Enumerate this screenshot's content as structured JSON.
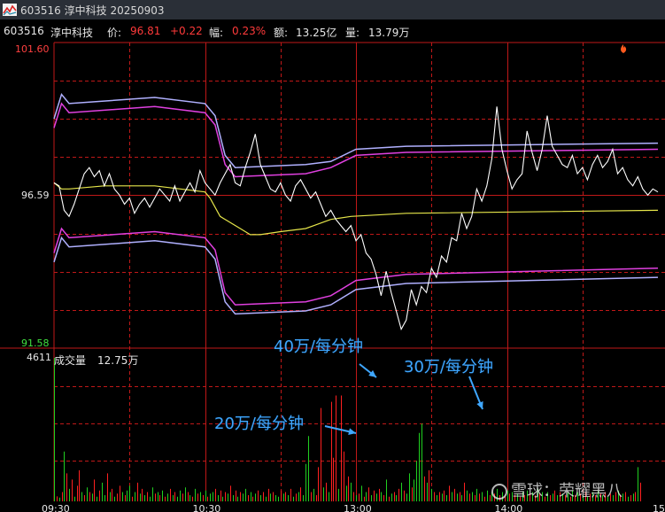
{
  "window": {
    "title": "603516 淳中科技 20250903"
  },
  "info": {
    "code": "603516",
    "name": "淳中科技",
    "price_label": "价:",
    "price": "96.81",
    "change": "+0.22",
    "amplitude_label": "幅:",
    "amplitude": "0.23%",
    "amount_label": "额:",
    "amount": "13.25亿",
    "volume_label": "量:",
    "volume": "13.79万"
  },
  "price_axis": {
    "top": "101.60",
    "mid": "96.59",
    "bottom": "91.58"
  },
  "volume_panel": {
    "max_label": "4611",
    "title": "成交量",
    "total": "12.75万"
  },
  "time_axis": [
    "09:30",
    "10:30",
    "13:00",
    "14:00",
    "15:0"
  ],
  "annotations": {
    "a40": "40万/每分钟",
    "a30": "30万/每分钟",
    "a20": "20万/每分钟"
  },
  "watermark": "雪球：荣耀黑八",
  "colors": {
    "background": "#000000",
    "grid_red": "#c01818",
    "price_line": "#ffffff",
    "avg_line": "#e6e64a",
    "band_magenta": "#e040e0",
    "band_lavender": "#b0b0ff",
    "up": "#ff2020",
    "down": "#20d020",
    "annotation": "#3fa7ff"
  },
  "chart_data": {
    "type": "line",
    "title": "",
    "ylim": [
      91.58,
      101.6
    ],
    "price_x": [
      0,
      2,
      4,
      6,
      8,
      10,
      12,
      14,
      16,
      18,
      20,
      22,
      24,
      26,
      28,
      30,
      32,
      34,
      36,
      38,
      40,
      42,
      44,
      46,
      48,
      50,
      52,
      54,
      56,
      58,
      60,
      62,
      64,
      66,
      68,
      70,
      72,
      74,
      76,
      78,
      80,
      82,
      84,
      86,
      88,
      90,
      92,
      94,
      96,
      98,
      100,
      102,
      104,
      106,
      108,
      110,
      112,
      114,
      116,
      118,
      120,
      122,
      124,
      126,
      128,
      130,
      132,
      134,
      136,
      138,
      140,
      142,
      144,
      146,
      148,
      150,
      152,
      154,
      156,
      158,
      160,
      162,
      164,
      166,
      168,
      170,
      172,
      174,
      176,
      178,
      180,
      182,
      184,
      186,
      188,
      190,
      192,
      194,
      196,
      198,
      200,
      202,
      204,
      206,
      208,
      210,
      212,
      214,
      216,
      218,
      220,
      222,
      224,
      226,
      228,
      230,
      232,
      234,
      236,
      238,
      240
    ],
    "price": [
      97.0,
      96.9,
      96.1,
      95.9,
      96.3,
      96.8,
      97.3,
      97.5,
      97.2,
      97.4,
      96.9,
      97.3,
      96.8,
      96.6,
      96.3,
      96.5,
      96.0,
      96.3,
      96.5,
      96.2,
      96.5,
      96.8,
      96.6,
      96.4,
      96.9,
      96.4,
      96.7,
      97.0,
      96.7,
      97.4,
      97.0,
      96.8,
      96.6,
      97.0,
      97.3,
      97.6,
      97.0,
      96.9,
      97.5,
      98.0,
      98.6,
      97.6,
      97.2,
      96.8,
      96.7,
      97.0,
      96.6,
      96.4,
      96.9,
      97.1,
      96.8,
      96.5,
      96.7,
      96.3,
      95.9,
      96.1,
      95.8,
      95.6,
      95.4,
      95.6,
      95.1,
      95.3,
      94.7,
      94.5,
      94.0,
      93.3,
      94.1,
      93.4,
      92.8,
      92.2,
      92.5,
      93.5,
      93.0,
      93.6,
      93.4,
      94.2,
      93.9,
      94.6,
      94.4,
      95.2,
      95.1,
      96.0,
      95.5,
      95.9,
      96.8,
      96.4,
      96.9,
      97.8,
      99.5,
      98.1,
      97.4,
      96.8,
      97.1,
      97.3,
      98.7,
      98.0,
      97.4,
      98.1,
      99.2,
      98.2,
      97.9,
      97.6,
      97.5,
      97.9,
      97.3,
      97.5,
      97.1,
      97.6,
      97.9,
      97.5,
      97.7,
      98.1,
      97.3,
      97.5,
      97.1,
      96.9,
      97.2,
      96.8,
      96.6,
      96.8,
      96.7
    ],
    "series": [
      {
        "values_x": [
          0,
          3,
          6,
          20,
          40,
          60,
          62,
          66,
          70,
          74,
          78,
          82,
          90,
          100,
          110,
          118,
          140,
          240
        ],
        "values": [
          97.0,
          96.8,
          96.8,
          96.9,
          96.9,
          96.7,
          96.5,
          95.9,
          95.7,
          95.5,
          95.3,
          95.3,
          95.4,
          95.5,
          95.8,
          95.9,
          96.0,
          96.1
        ]
      },
      {
        "values_x": [
          0,
          3,
          6,
          40,
          60,
          64,
          68,
          72,
          100,
          110,
          120,
          140,
          240
        ],
        "values": [
          99.1,
          99.9,
          99.6,
          99.8,
          99.6,
          99.2,
          97.9,
          97.5,
          97.6,
          97.7,
          98.1,
          98.2,
          98.3
        ]
      },
      {
        "values_x": [
          0,
          3,
          6,
          40,
          60,
          64,
          68,
          72,
          100,
          110,
          120,
          140,
          240
        ],
        "values": [
          98.8,
          99.6,
          99.3,
          99.5,
          99.3,
          98.9,
          97.6,
          97.2,
          97.3,
          97.5,
          97.9,
          98.0,
          98.1
        ]
      },
      {
        "values_x": [
          0,
          3,
          6,
          40,
          60,
          64,
          68,
          72,
          100,
          110,
          120,
          140,
          240
        ],
        "values": [
          94.7,
          95.5,
          95.2,
          95.4,
          95.2,
          94.8,
          93.4,
          93.0,
          93.1,
          93.3,
          93.8,
          94.0,
          94.2
        ]
      },
      {
        "values_x": [
          0,
          3,
          6,
          40,
          60,
          64,
          68,
          72,
          100,
          110,
          120,
          140,
          240
        ],
        "values": [
          94.4,
          95.2,
          94.9,
          95.1,
          94.9,
          94.5,
          93.1,
          92.7,
          92.8,
          93.0,
          93.5,
          93.7,
          93.9
        ]
      }
    ],
    "volume_ylim": [
      0,
      4611
    ],
    "volume": [
      4611,
      160,
      120,
      300,
      1600,
      900,
      400,
      700,
      150,
      500,
      1000,
      300,
      200,
      450,
      300,
      250,
      700,
      150,
      350,
      600,
      200,
      900,
      300,
      400,
      150,
      250,
      500,
      300,
      200,
      350,
      500,
      150,
      300,
      600,
      250,
      400,
      200,
      300,
      150,
      450,
      250,
      300,
      200,
      350,
      150,
      250,
      400,
      200,
      300,
      150,
      350,
      250,
      450,
      300,
      200,
      150,
      400,
      250,
      300,
      200,
      350,
      150,
      250,
      300,
      400,
      200,
      350,
      150,
      300,
      250,
      500,
      200,
      350,
      150,
      300,
      250,
      400,
      200,
      300,
      150,
      250,
      350,
      200,
      300,
      150,
      400,
      250,
      300,
      200,
      150,
      350,
      250,
      300,
      200,
      400,
      150,
      250,
      300,
      450,
      200,
      1200,
      2100,
      300,
      400,
      200,
      1100,
      3000,
      450,
      600,
      300,
      3200,
      1400,
      3400,
      400,
      3400,
      1600,
      500,
      800,
      600,
      300,
      200,
      250,
      500,
      150,
      300,
      450,
      200,
      350,
      250,
      400,
      300,
      200,
      700,
      150,
      250,
      300,
      200,
      400,
      600,
      350,
      250,
      900,
      450,
      700,
      1300,
      2200,
      2500,
      800,
      600,
      1000,
      400,
      300,
      200,
      300,
      250,
      350,
      200,
      500,
      300,
      400,
      250,
      300,
      200,
      600,
      350,
      250,
      300,
      200,
      400,
      250,
      300,
      150,
      350,
      200,
      300,
      250,
      400,
      200,
      300,
      150,
      350,
      250,
      300,
      200,
      250,
      150,
      300,
      200,
      350,
      250,
      300,
      200,
      400,
      250,
      300,
      150,
      300,
      200,
      250,
      350,
      200,
      300,
      250,
      200,
      300,
      150,
      350,
      200,
      300,
      250,
      200,
      300,
      150,
      250,
      300,
      200,
      350,
      250,
      200,
      300,
      150,
      250,
      200,
      300,
      350,
      200,
      250,
      300,
      150,
      200,
      250,
      300,
      1100,
      600
    ],
    "volume_dir": [
      1,
      0,
      1,
      0,
      1,
      0,
      1,
      0,
      1,
      0,
      0,
      1,
      0,
      1,
      0,
      1,
      0,
      1,
      0,
      1,
      1,
      0,
      1,
      0,
      1,
      0,
      0,
      1,
      0,
      1,
      1,
      0,
      1,
      0,
      1,
      0,
      1,
      0,
      1,
      1,
      0,
      1,
      0,
      1,
      0,
      1,
      0,
      1,
      0,
      1,
      1,
      0,
      1,
      0,
      1,
      0,
      1,
      0,
      1,
      0,
      1,
      0,
      1,
      1,
      0,
      1,
      0,
      1,
      0,
      1,
      0,
      1,
      0,
      1,
      0,
      1,
      1,
      0,
      1,
      0,
      1,
      0,
      1,
      0,
      1,
      0,
      1,
      0,
      1,
      1,
      0,
      1,
      0,
      1,
      0,
      1,
      0,
      1,
      0,
      1,
      1,
      1,
      0,
      1,
      0,
      0,
      0,
      1,
      0,
      1,
      0,
      0,
      0,
      1,
      0,
      0,
      1,
      0,
      1,
      0,
      1,
      0,
      1,
      0,
      1,
      0,
      1,
      0,
      1,
      0,
      1,
      0,
      1,
      0,
      1,
      0,
      1,
      0,
      1,
      0,
      1,
      1,
      0,
      1,
      1,
      1,
      1,
      0,
      1,
      0,
      1,
      0,
      1,
      0,
      1,
      0,
      1,
      0,
      1,
      0,
      1,
      0,
      1,
      0,
      1,
      0,
      1,
      0,
      1,
      0,
      1,
      0,
      1,
      0,
      1,
      0,
      1,
      0,
      1,
      0,
      1,
      0,
      1,
      0,
      1,
      0,
      1,
      0,
      1,
      0,
      1,
      0,
      1,
      0,
      1,
      0,
      1,
      0,
      1,
      0,
      1,
      0,
      1,
      0,
      1,
      0,
      1,
      0,
      1,
      0,
      1,
      0,
      1,
      0,
      1,
      0,
      1,
      0,
      1,
      0,
      1,
      0,
      1,
      0,
      1,
      0,
      1,
      0,
      1,
      0,
      1,
      0,
      1,
      0,
      1,
      0,
      1,
      0,
      1,
      0,
      0,
      1
    ]
  }
}
